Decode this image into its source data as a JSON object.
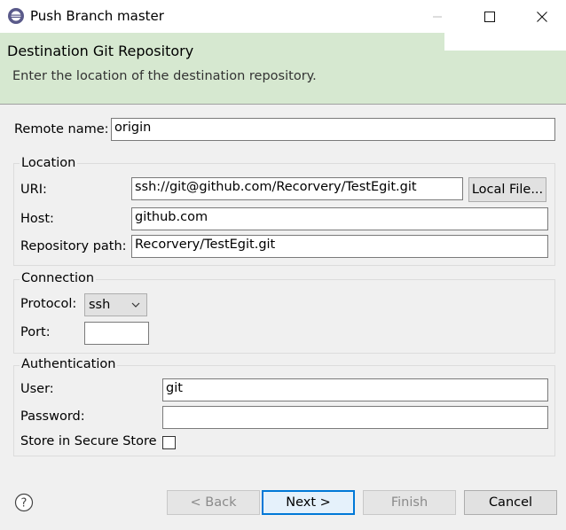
{
  "window": {
    "title": "Push Branch master",
    "app_icon": "eclipse-icon"
  },
  "banner": {
    "title": "Destination Git Repository",
    "description": "Enter the location of the destination repository."
  },
  "remote": {
    "label": "Remote name:",
    "value": "origin"
  },
  "location": {
    "title": "Location",
    "uri_label": "URI:",
    "uri_value": "ssh://git@github.com/Recorvery/TestEgit.git",
    "local_file_button": "Local File...",
    "host_label": "Host:",
    "host_value": "github.com",
    "repo_label": "Repository path:",
    "repo_value": "Recorvery/TestEgit.git"
  },
  "connection": {
    "title": "Connection",
    "protocol_label": "Protocol:",
    "protocol_value": "ssh",
    "port_label": "Port:",
    "port_value": ""
  },
  "authentication": {
    "title": "Authentication",
    "user_label": "User:",
    "user_value": "git",
    "password_label": "Password:",
    "password_value": "",
    "store_label": "Store in Secure Store",
    "store_checked": false
  },
  "footer": {
    "back": "< Back",
    "next": "Next >",
    "finish": "Finish",
    "cancel": "Cancel"
  }
}
